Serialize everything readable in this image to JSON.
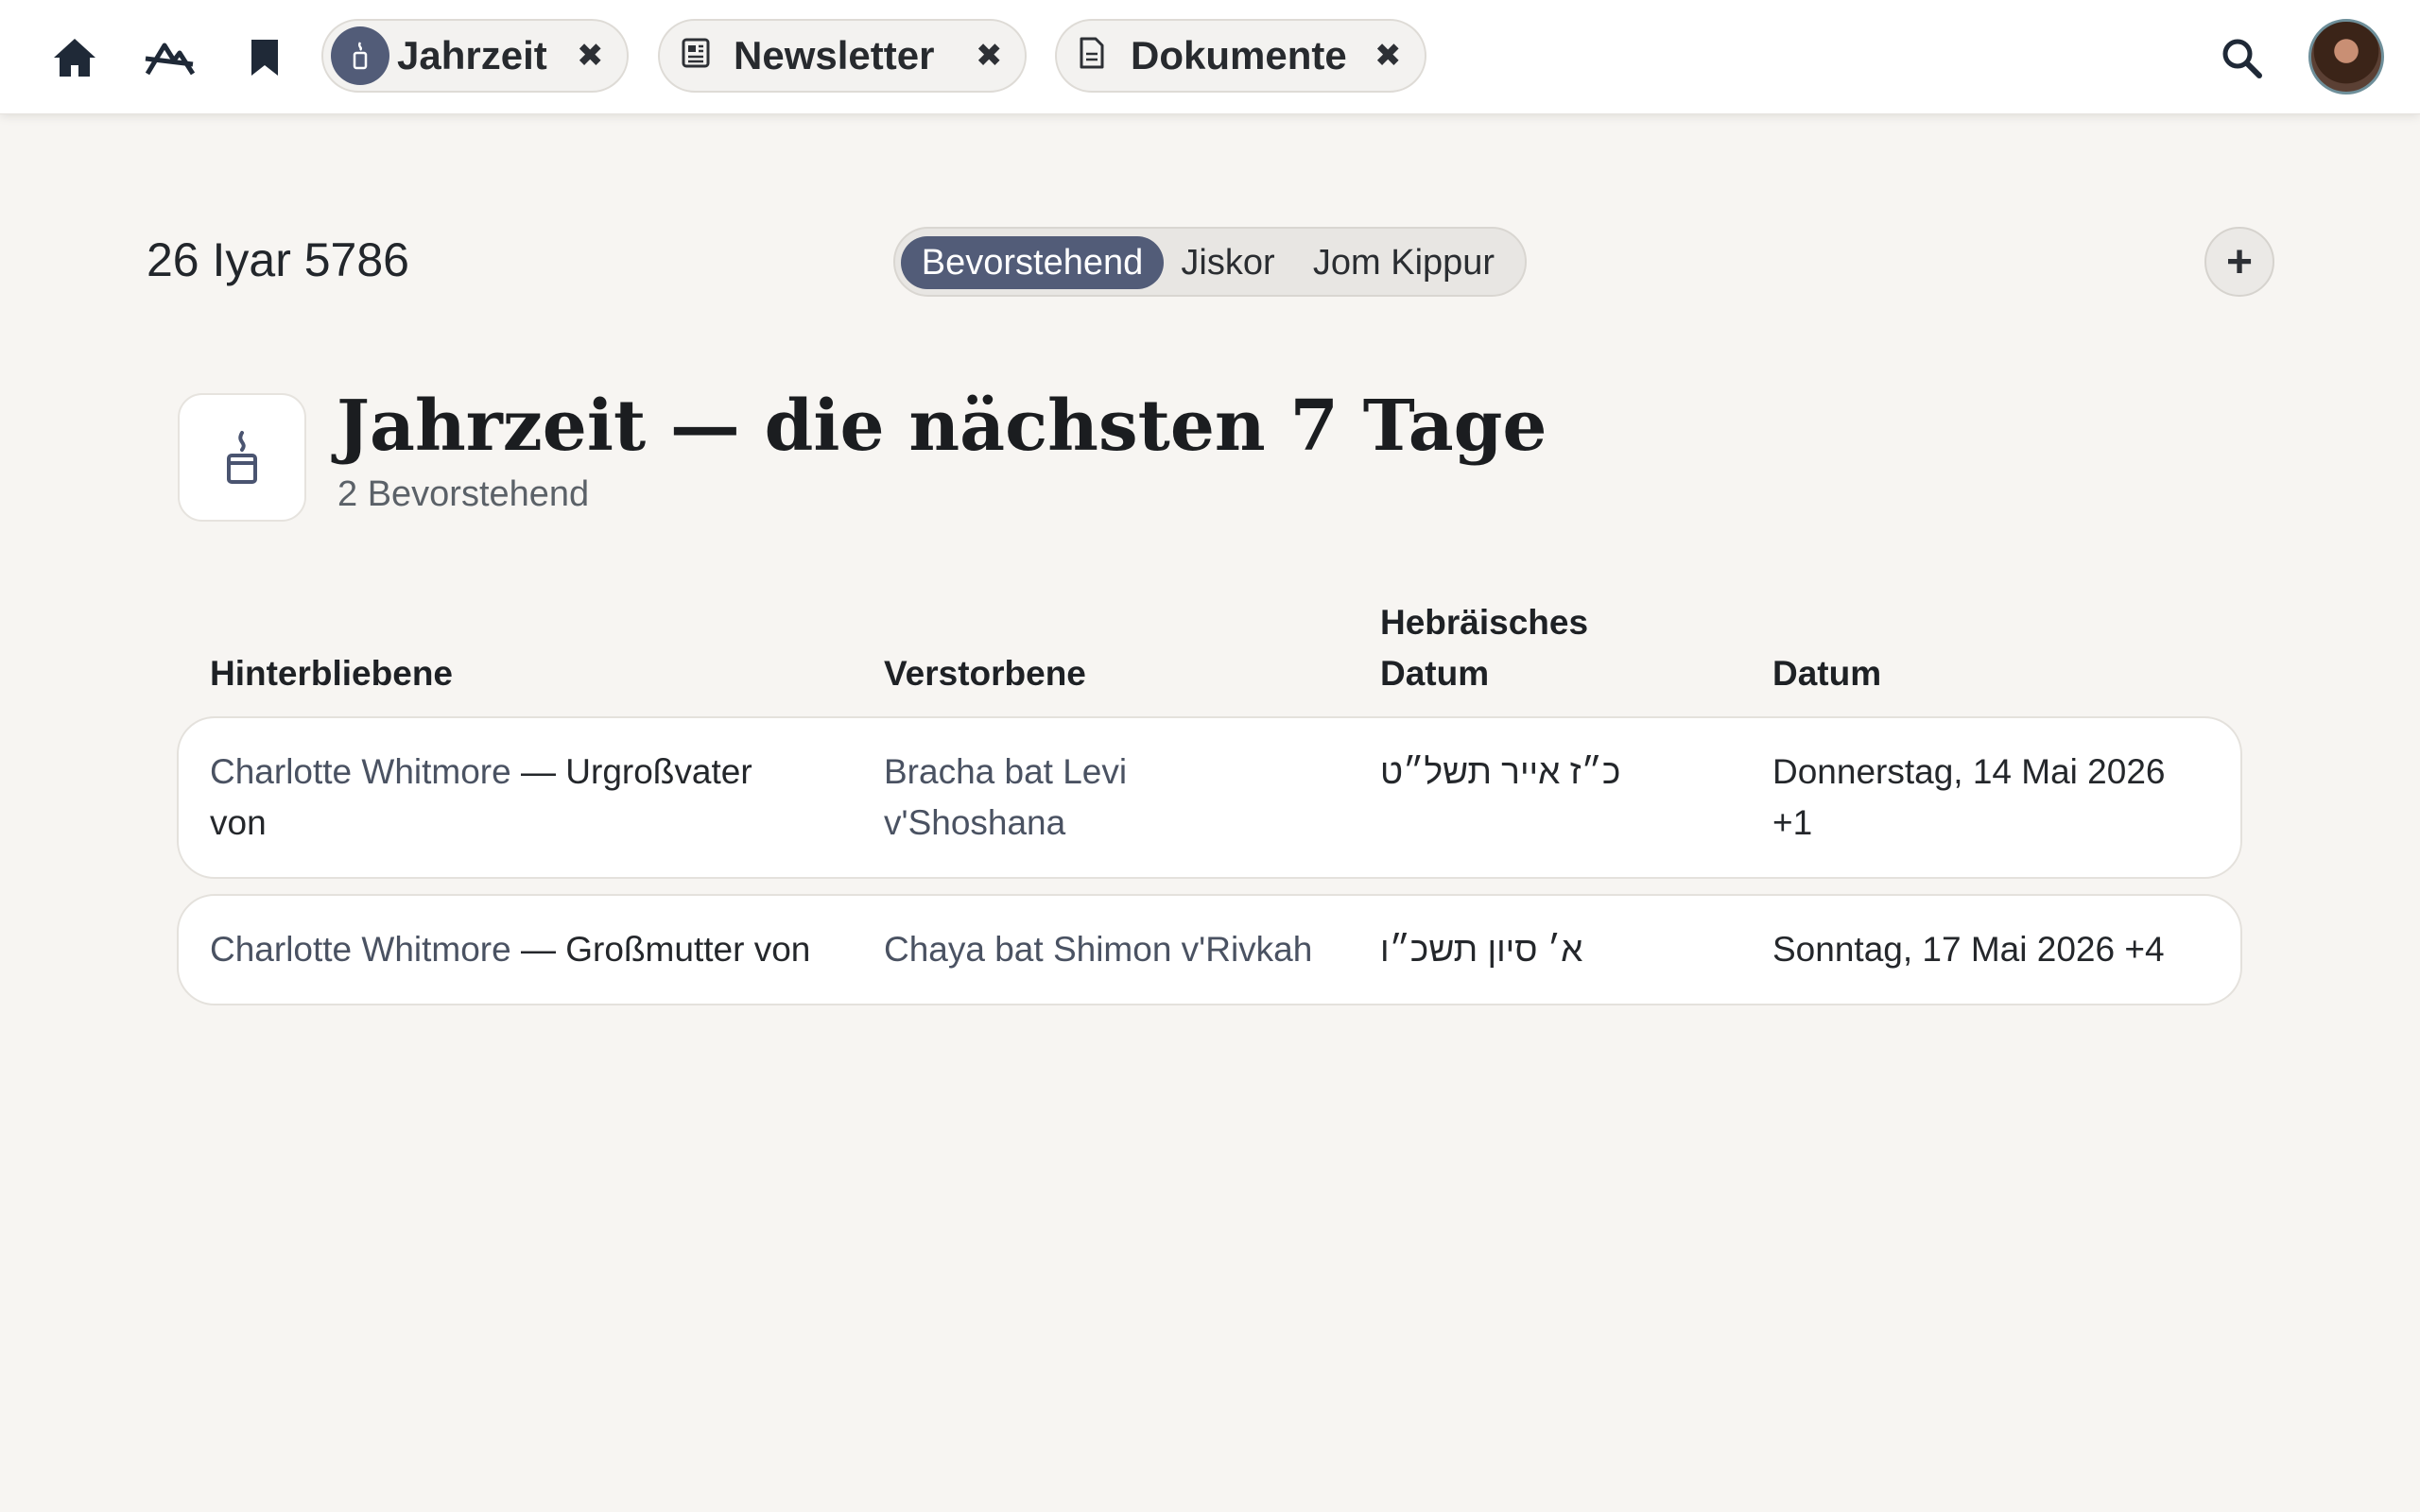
{
  "nav": {
    "icons": [
      "home-icon",
      "mountains-icon",
      "bookmark-icon",
      "search-icon"
    ]
  },
  "tabs": [
    {
      "label": "Jahrzeit",
      "icon": "candle-icon",
      "close": "✖"
    },
    {
      "label": "Newsletter",
      "icon": "newspaper-icon",
      "close": "✖"
    },
    {
      "label": "Dokumente",
      "icon": "document-icon",
      "close": "✖"
    }
  ],
  "controls": {
    "hebrew_date": "26 Iyar 5786",
    "segments": [
      "Bevorstehend",
      "Jiskor",
      "Jom Kippur"
    ],
    "active_segment": "Bevorstehend",
    "add_label": "+"
  },
  "heading": {
    "title": "Jahrzeit — die nächsten 7 Tage",
    "subtitle": "2 Bevorstehend"
  },
  "table": {
    "columns": {
      "mourner": "Hinterbliebene",
      "deceased": "Verstorbene",
      "hebrew_date_line1": "Hebräisches",
      "hebrew_date_line2": "Datum",
      "date": "Datum"
    },
    "rows": [
      {
        "mourner_name": "Charlotte Whitmore",
        "relation_line1": " — Urgroßvater",
        "relation_line2": "von",
        "deceased_line1": "Bracha bat Levi",
        "deceased_line2": "v'Shoshana",
        "hebrew_date": "כ״ז אייר תשל״ט",
        "date_line1": "Donnerstag, 14 Mai 2026",
        "date_line2": "+1"
      },
      {
        "mourner_name": "Charlotte Whitmore",
        "relation_line1": " — Großmutter von",
        "relation_line2": "",
        "deceased_line1": "Chaya bat Shimon v'Rivkah",
        "deceased_line2": "",
        "hebrew_date": "א׳ סיון תשכ״ו",
        "date_line1": "Sonntag, 17 Mai 2026 +4",
        "date_line2": ""
      }
    ]
  },
  "colors": {
    "accent": "#525c78",
    "background": "#f7f5f2",
    "surface": "#ffffff"
  }
}
